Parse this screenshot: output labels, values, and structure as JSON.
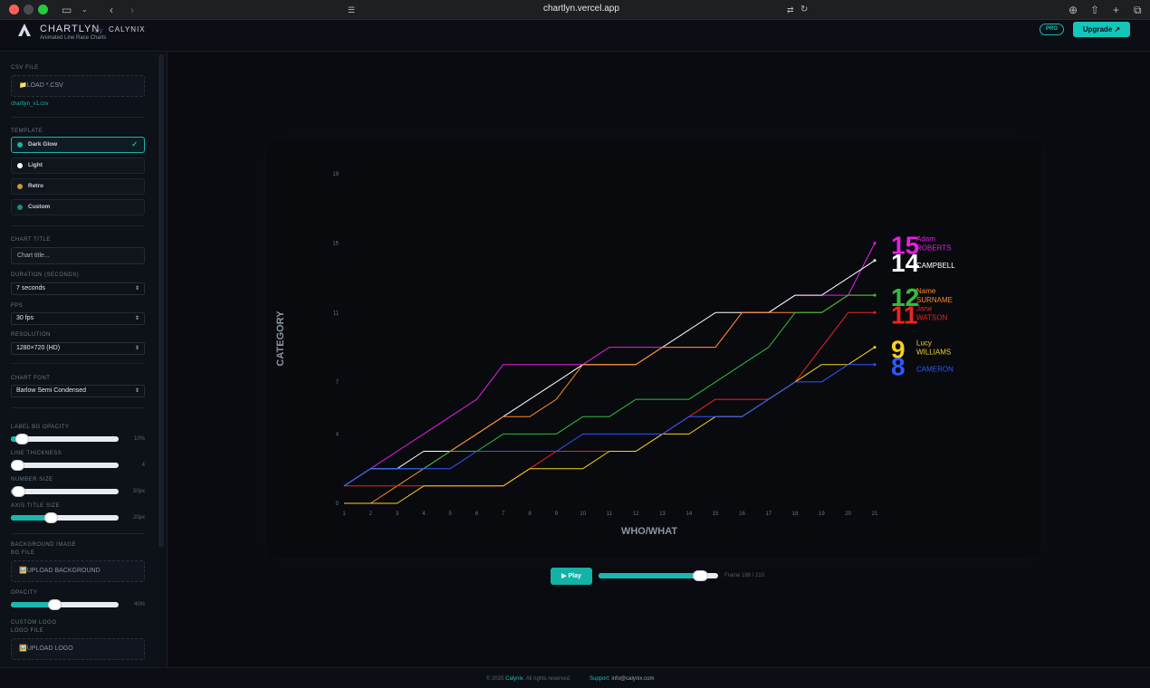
{
  "browser": {
    "url": "chartlyn.vercel.app"
  },
  "header": {
    "brand": "CHARTLYN",
    "by": "by",
    "company": "CALYNIX",
    "subtitle": "Animated Line Race Charts",
    "pro_badge": "PRO",
    "upgrade_label": "Upgrade ↗"
  },
  "sidebar": {
    "csv_label": "CSV FILE",
    "csv_drop": "📁LOAD *.CSV",
    "csv_file": "chartlyn_v1.csv",
    "template_label": "TEMPLATE",
    "templates": [
      {
        "label": "Dark Glow",
        "color": "#1bb3a8",
        "active": true
      },
      {
        "label": "Light",
        "color": "#ffffff",
        "active": false
      },
      {
        "label": "Retro",
        "color": "#c99a2b",
        "active": false
      },
      {
        "label": "Custom",
        "color": "#1a8c86",
        "active": false
      }
    ],
    "check_mark": "✓",
    "chart_title_label": "CHART TITLE",
    "chart_title_placeholder": "Chart title...",
    "duration_label": "DURATION (SECONDS)",
    "duration_value": "7 seconds",
    "fps_label": "FPS",
    "fps_value": "30 fps",
    "resolution_label": "RESOLUTION",
    "resolution_value": "1280×720 (HD)",
    "font_label": "CHART FONT",
    "font_value": "Barlow Semi Condensed",
    "label_bg_label": "LABEL BG OPACITY",
    "label_bg_value": "10%",
    "label_bg_fraction": 0.1,
    "line_thickness_label": "LINE THICKNESS",
    "line_thickness_value": "4",
    "line_thickness_fraction": 0.06,
    "number_size_label": "NUMBER SIZE",
    "number_size_value": "50px",
    "number_size_fraction": 0.07,
    "axis_title_label": "AXIS TITLE SIZE",
    "axis_title_value": "20px",
    "axis_title_fraction": 0.37,
    "bg_image_label": "BACKGROUND IMAGE",
    "bg_file_label": "BG FILE",
    "bg_upload": "🖼️UPLOAD BACKGROUND",
    "opacity_label": "OPACITY",
    "opacity_value": "40%",
    "opacity_fraction": 0.4,
    "custom_logo_label": "CUSTOM LOGO",
    "logo_file_label": "LOGO FILE",
    "logo_upload": "🖼️UPLOAD LOGO"
  },
  "player": {
    "play_label": "▶ Play",
    "frames_text": "Frame 188 / 210",
    "progress": 0.895
  },
  "footer": {
    "copyright_pre": "© 2025 ",
    "copyright_brand": "Calynix",
    "copyright_post": ". All rights reserved.",
    "support_label": "Support:",
    "support_email": "info@calynix.com"
  },
  "chart_data": {
    "type": "line",
    "xlabel": "WHO/WHAT",
    "ylabel": "CATEGORY",
    "x": [
      1,
      2,
      3,
      4,
      5,
      6,
      7,
      8,
      9,
      10,
      11,
      12,
      13,
      14,
      15,
      16,
      17,
      18,
      19,
      20,
      21
    ],
    "ylim": [
      0,
      19
    ],
    "yticks": [
      0,
      4,
      7,
      11,
      15,
      19
    ],
    "series": [
      {
        "first": "Adam",
        "last": "ROBERTS",
        "color": "#e61fe6",
        "final": 15,
        "values": [
          1,
          2,
          3,
          4,
          5,
          6,
          8,
          8,
          8,
          8,
          9,
          9,
          9,
          9,
          9,
          11,
          11,
          12,
          12,
          12,
          15
        ]
      },
      {
        "first": "",
        "last": "CAMPBELL",
        "color": "#ffffff",
        "final": 14,
        "values": [
          1,
          2,
          2,
          3,
          3,
          4,
          5,
          6,
          7,
          8,
          8,
          8,
          9,
          10,
          11,
          11,
          11,
          12,
          12,
          13,
          14
        ]
      },
      {
        "first": "Name",
        "last": "SURNAME",
        "color": "#ff8a1e",
        "final": 12,
        "values": [
          0,
          0,
          1,
          2,
          3,
          4,
          5,
          5,
          6,
          8,
          8,
          8,
          9,
          9,
          9,
          11,
          11,
          11,
          11,
          12,
          12
        ]
      },
      {
        "first": "Jane",
        "last": "WATSON",
        "color": "#f0231e",
        "final": 11,
        "values": [
          1,
          1,
          1,
          1,
          1,
          1,
          1,
          2,
          3,
          3,
          3,
          3,
          4,
          5,
          6,
          6,
          6,
          7,
          9,
          11,
          11
        ]
      },
      {
        "first": "",
        "last": "",
        "color": "#2fbf3a",
        "final": 12,
        "values": [
          1,
          2,
          2,
          2,
          3,
          3,
          4,
          4,
          4,
          5,
          5,
          6,
          6,
          6,
          7,
          8,
          9,
          11,
          11,
          12,
          12
        ]
      },
      {
        "first": "Lucy",
        "last": "WILLIAMS",
        "color": "#f6d21f",
        "final": 9,
        "values": [
          0,
          0,
          0,
          1,
          1,
          1,
          1,
          2,
          2,
          2,
          3,
          3,
          4,
          4,
          5,
          5,
          6,
          7,
          8,
          8,
          9
        ]
      },
      {
        "first": "",
        "last": "CAMERON",
        "color": "#2f57ff",
        "final": 8,
        "values": [
          1,
          2,
          2,
          2,
          2,
          3,
          3,
          3,
          3,
          4,
          4,
          4,
          4,
          5,
          5,
          5,
          6,
          7,
          7,
          8,
          8
        ]
      }
    ]
  }
}
